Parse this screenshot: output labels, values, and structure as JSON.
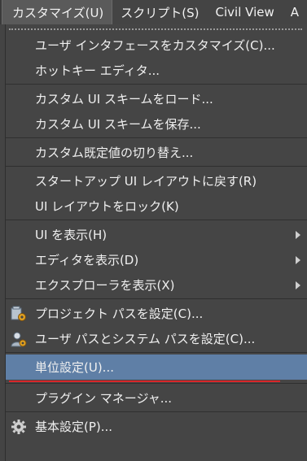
{
  "menubar": {
    "items": [
      {
        "label": "カスタマイズ(U)",
        "active": true
      },
      {
        "label": "スクリプト(S)",
        "active": false
      },
      {
        "label": "Civil View",
        "active": false
      },
      {
        "label": "A",
        "active": false
      }
    ]
  },
  "menu": {
    "items": [
      {
        "label": "ユーザ インタフェースをカスタマイズ(C)..."
      },
      {
        "label": "ホットキー エディタ..."
      },
      {
        "label": "カスタム UI スキームをロード..."
      },
      {
        "label": "カスタム UI スキームを保存..."
      },
      {
        "label": "カスタム既定値の切り替え..."
      },
      {
        "label": "スタートアップ UI レイアウトに戻す(R)"
      },
      {
        "label": "UI レイアウトをロック(K)"
      },
      {
        "label": "UI を表示(H)"
      },
      {
        "label": "エディタを表示(D)"
      },
      {
        "label": "エクスプローラを表示(X)"
      },
      {
        "label": "プロジェクト パスを設定(C)..."
      },
      {
        "label": "ユーザ パスとシステム パスを設定(C)..."
      },
      {
        "label": "単位設定(U)..."
      },
      {
        "label": "プラグイン マネージャ..."
      },
      {
        "label": "基本設定(P)..."
      }
    ]
  },
  "colors": {
    "background": "#444444",
    "highlight": "#5f7fa6",
    "annotation_underline": "#d9262a"
  }
}
